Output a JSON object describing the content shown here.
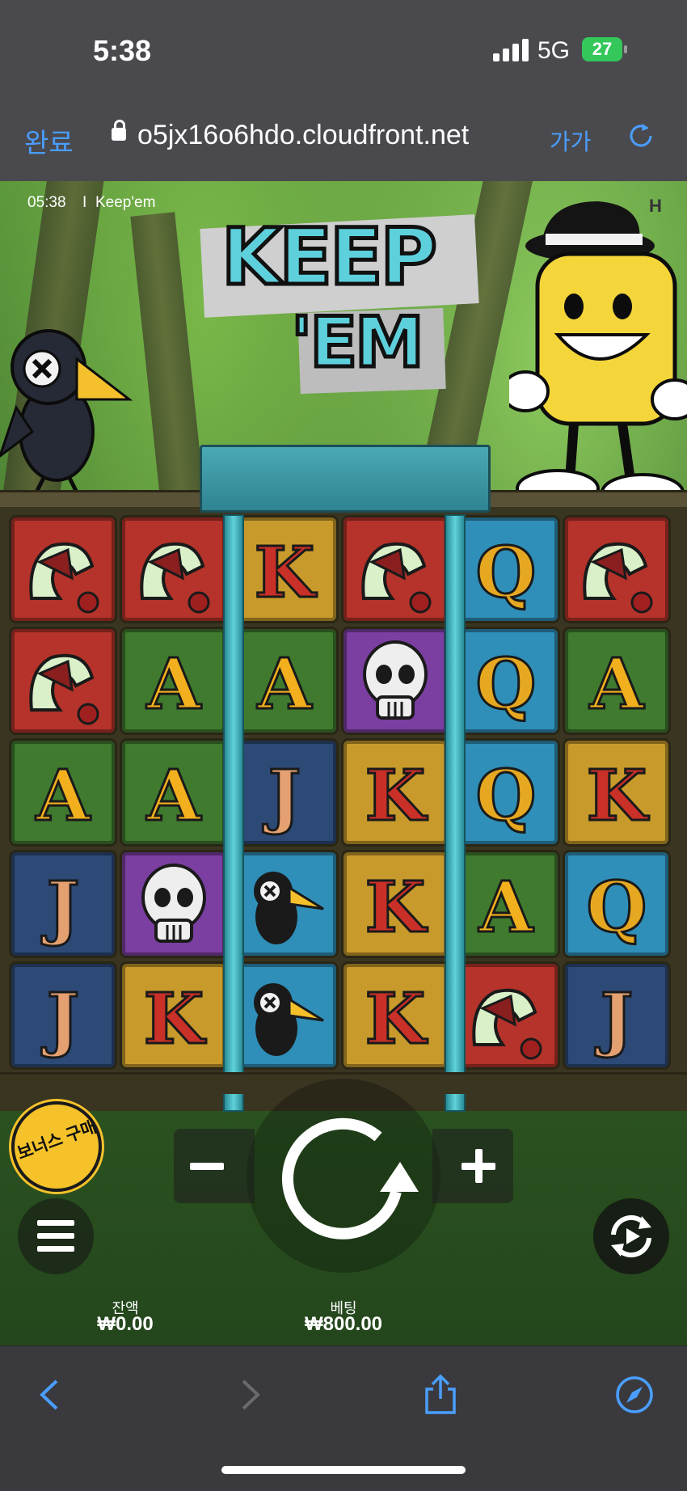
{
  "status_bar": {
    "time": "5:38",
    "network": "5G",
    "battery": "27"
  },
  "browser": {
    "done_label": "완료",
    "url": "o5jx16o6hdo.cloudfront.net",
    "text_size_label": "가가"
  },
  "game": {
    "clock": "05:38",
    "separator": "I",
    "name": "Keep'em",
    "brand": "H",
    "logo_line1": "KEEP",
    "logo_line2": "'EM",
    "bonus_label": "보너스 구매",
    "balance_label": "잔액",
    "balance_value": "₩0.00",
    "bet_label": "베팅",
    "bet_value": "₩800.00"
  },
  "reels": [
    [
      "snake",
      "snake",
      "A",
      "J",
      "J"
    ],
    [
      "snake",
      "A",
      "A",
      "skull",
      "K"
    ],
    [
      "K",
      "A",
      "J",
      "crow",
      "crow"
    ],
    [
      "snake",
      "skull",
      "K",
      "K",
      "K"
    ],
    [
      "Q",
      "Q",
      "Q",
      "A",
      "snake"
    ],
    [
      "snake",
      "A",
      "K",
      "Q",
      "J"
    ]
  ],
  "symbol_colors": {
    "snake": "#b5332a",
    "A": "#3f7a2f",
    "J": "#2d4a77",
    "K": "#c79a2b",
    "Q": "#2f8fb8",
    "skull": "#7a3fa0",
    "crow": "#2f8fb8"
  },
  "symbol_letter_colors": {
    "A": "#f2b01e",
    "J": "#e4a070",
    "K": "#c83028",
    "Q": "#e6a821"
  },
  "icons": {
    "crow": "crow-icon",
    "snake": "snake-icon",
    "skull": "skull-icon",
    "spin": "spin-arrow-icon",
    "menu": "hamburger-icon",
    "autoplay": "autoplay-icon",
    "back": "chevron-left-icon",
    "forward": "chevron-right-icon",
    "share": "share-icon",
    "compass": "compass-icon"
  }
}
